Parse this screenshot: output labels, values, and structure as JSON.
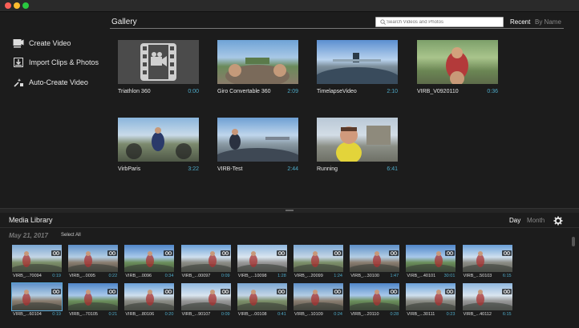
{
  "sidebar": {
    "items": [
      {
        "label": "Create Video",
        "icon": "create-video-icon"
      },
      {
        "label": "Import Clips & Photos",
        "icon": "import-icon"
      },
      {
        "label": "Auto-Create Video",
        "icon": "auto-create-icon"
      }
    ]
  },
  "gallery": {
    "title": "Gallery",
    "search_placeholder": "Search Videos and Photos",
    "sort_recent": "Recent",
    "sort_byname": "By Name",
    "videos": [
      {
        "name": "Triathlon 360",
        "duration": "0:00"
      },
      {
        "name": "Giro Convertable 360",
        "duration": "2:09"
      },
      {
        "name": "TimelapseVideo",
        "duration": "2:10"
      },
      {
        "name": "VIRB_V0920110",
        "duration": "0:36"
      },
      {
        "name": "VirbParis",
        "duration": "3:22"
      },
      {
        "name": "VIRB-Test",
        "duration": "2:44"
      },
      {
        "name": "Running",
        "duration": "6:41"
      }
    ]
  },
  "library": {
    "title": "Media Library",
    "view_day": "Day",
    "view_month": "Month",
    "date": "May 21, 2017",
    "select_all": "Select All",
    "row1": [
      {
        "name": "VIRB_...70094",
        "duration": "0:19"
      },
      {
        "name": "VIRB_...0095",
        "duration": "0:22"
      },
      {
        "name": "VIRB_...0096",
        "duration": "0:34"
      },
      {
        "name": "VIRB_...00097",
        "duration": "0:09"
      },
      {
        "name": "VIRB_...10098",
        "duration": "1:28"
      },
      {
        "name": "VIRB_...20099",
        "duration": "1:24"
      },
      {
        "name": "VIRB_...30100",
        "duration": "1:47"
      },
      {
        "name": "VIRB_...40101",
        "duration": "30:01"
      },
      {
        "name": "VIRB_...50103",
        "duration": "6:15"
      }
    ],
    "row2": [
      {
        "name": "VIRB_...60104",
        "duration": "0:19"
      },
      {
        "name": "VIRB_...70105",
        "duration": "0:21"
      },
      {
        "name": "VIRB_...80106",
        "duration": "0:20"
      },
      {
        "name": "VIRB_...90107",
        "duration": "0:09"
      },
      {
        "name": "VIRB_...00108",
        "duration": "0:41"
      },
      {
        "name": "VIRB_...10109",
        "duration": "0:24"
      },
      {
        "name": "VIRB_...20110",
        "duration": "0:28"
      },
      {
        "name": "VIRB_...30111",
        "duration": "0:23"
      },
      {
        "name": "VIRB_...40112",
        "duration": "6:15"
      }
    ]
  },
  "colors": {
    "accent_duration": "#4eaac8",
    "background": "#1c1c1c"
  }
}
